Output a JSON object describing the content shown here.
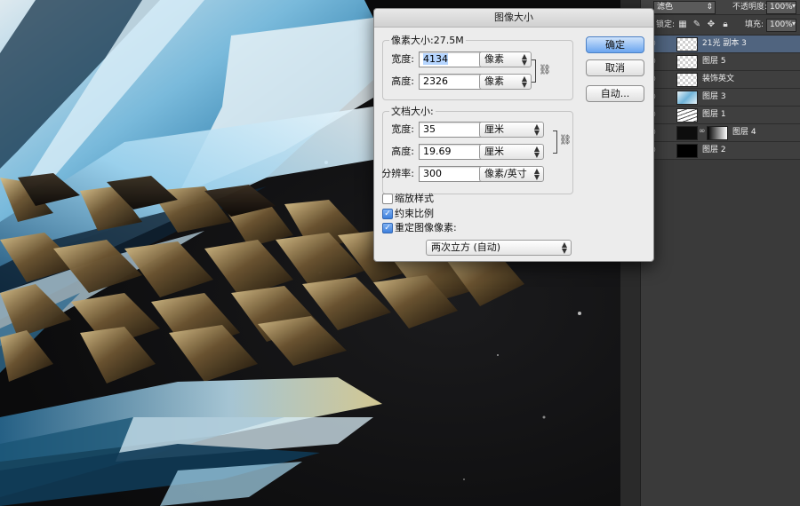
{
  "dialog": {
    "title": "图像大小",
    "pixel_dimensions": {
      "legend": "像素大小:27.5M",
      "width": {
        "label": "宽度:",
        "value": "4134",
        "unit": "像素"
      },
      "height": {
        "label": "高度:",
        "value": "2326",
        "unit": "像素"
      }
    },
    "document_size": {
      "legend": "文档大小:",
      "width": {
        "label": "宽度:",
        "value": "35",
        "unit": "厘米"
      },
      "height": {
        "label": "高度:",
        "value": "19.69",
        "unit": "厘米"
      },
      "resolution": {
        "label": "分辨率:",
        "value": "300",
        "unit": "像素/英寸"
      }
    },
    "buttons": {
      "ok": "确定",
      "cancel": "取消",
      "auto": "自动..."
    },
    "checkboxes": {
      "scale_styles": {
        "label": "缩放样式",
        "checked": false
      },
      "constrain": {
        "label": "约束比例",
        "checked": true
      },
      "resample": {
        "label": "重定图像像素:",
        "checked": true
      }
    },
    "resample_method": "两次立方 (自动)"
  },
  "layers_panel": {
    "blend_mode": "滤色",
    "opacity_label": "不透明度:",
    "opacity_value": "100%",
    "lock_label": "锁定:",
    "fill_label": "填充:",
    "fill_value": "100%",
    "layers": [
      {
        "name": "21光 副本 3",
        "selected": true,
        "thumb": "checker"
      },
      {
        "name": "图层 5",
        "selected": false,
        "thumb": "checker"
      },
      {
        "name": "装饰英文",
        "selected": false,
        "thumb": "checker"
      },
      {
        "name": "图层 3",
        "selected": false,
        "thumb": "blue"
      },
      {
        "name": "图层 1",
        "selected": false,
        "thumb": "lines"
      },
      {
        "name": "图层 4",
        "selected": false,
        "thumb": "dark-mask"
      },
      {
        "name": "图层 2",
        "selected": false,
        "thumb": "black"
      }
    ]
  },
  "colors": {
    "accent": "#6aa5ef",
    "selected_layer": "#50647f"
  }
}
